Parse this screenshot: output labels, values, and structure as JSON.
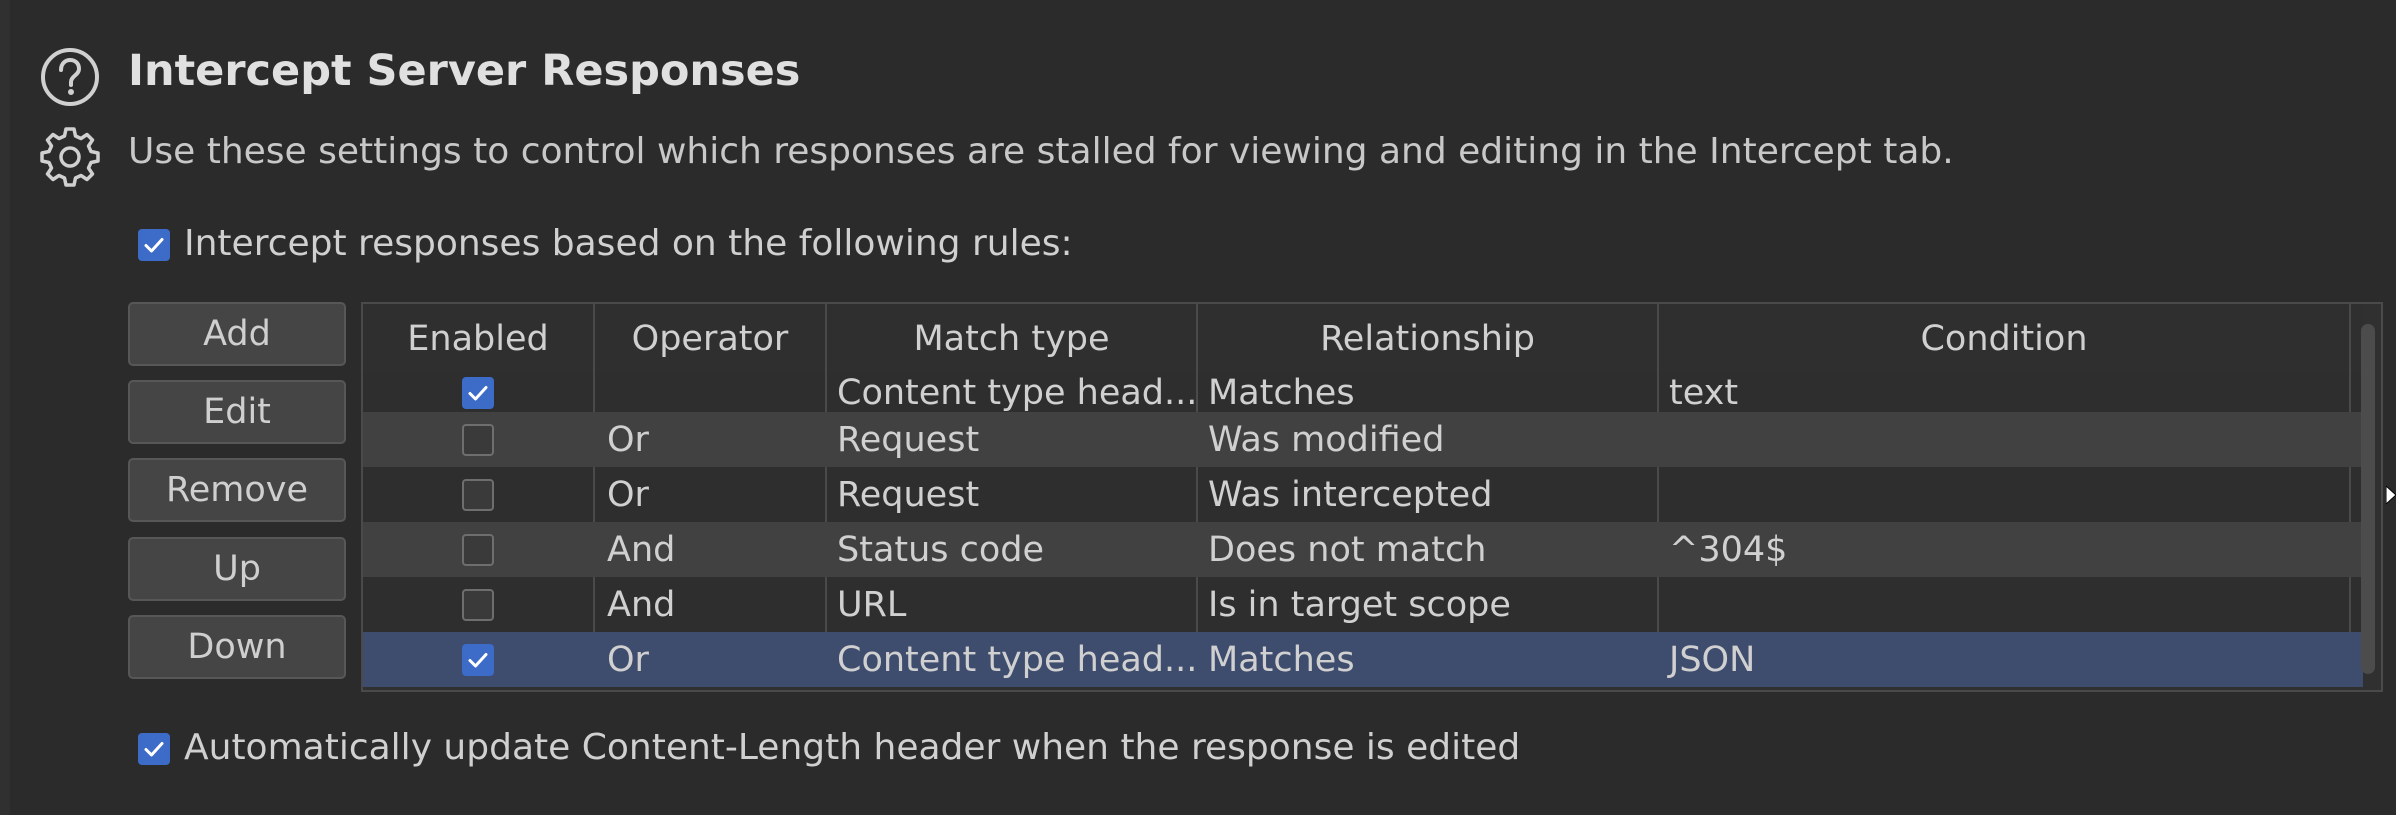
{
  "header": {
    "title": "Intercept Server Responses",
    "description": "Use these settings to control which responses are stalled for viewing and editing in the Intercept tab."
  },
  "intercept_rules_checkbox": {
    "label": "Intercept responses based on the following rules:",
    "checked": true
  },
  "buttons": {
    "add": "Add",
    "edit": "Edit",
    "remove": "Remove",
    "up": "Up",
    "down": "Down"
  },
  "table": {
    "columns": [
      "Enabled",
      "Operator",
      "Match type",
      "Relationship",
      "Condition"
    ],
    "rows": [
      {
        "enabled": true,
        "operator": "",
        "match_type": "Content type head...",
        "relationship": "Matches",
        "condition": "text"
      },
      {
        "enabled": false,
        "operator": "Or",
        "match_type": "Request",
        "relationship": "Was modified",
        "condition": ""
      },
      {
        "enabled": false,
        "operator": "Or",
        "match_type": "Request",
        "relationship": "Was intercepted",
        "condition": ""
      },
      {
        "enabled": false,
        "operator": "And",
        "match_type": "Status code",
        "relationship": "Does not match",
        "condition": "^304$"
      },
      {
        "enabled": false,
        "operator": "And",
        "match_type": "URL",
        "relationship": "Is in target scope",
        "condition": ""
      },
      {
        "enabled": true,
        "operator": "Or",
        "match_type": "Content type head...",
        "relationship": "Matches",
        "condition": "JSON"
      }
    ]
  },
  "auto_update_checkbox": {
    "label": "Automatically update Content-Length header when the response is edited",
    "checked": true
  },
  "icons": {
    "help": "help-circle-icon",
    "settings": "gear-icon"
  },
  "colors": {
    "background": "#2b2b2b",
    "checkbox_checked": "#3d6bc8",
    "selected_row": "#3e4c6e"
  }
}
